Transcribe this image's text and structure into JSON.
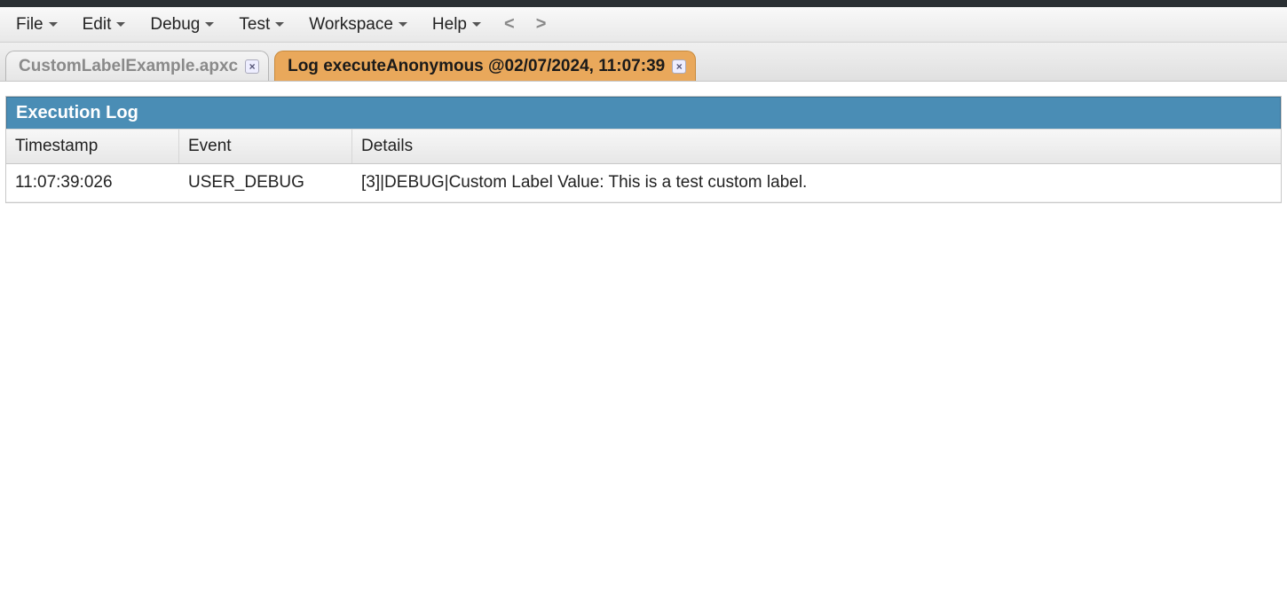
{
  "menu": {
    "items": [
      "File",
      "Edit",
      "Debug",
      "Test",
      "Workspace",
      "Help"
    ],
    "back": "<",
    "forward": ">"
  },
  "tabs": [
    {
      "label": "CustomLabelExample.apxc",
      "active": false
    },
    {
      "label": "Log executeAnonymous @02/07/2024, 11:07:39",
      "active": true
    }
  ],
  "panel": {
    "title": "Execution Log",
    "columns": {
      "timestamp": "Timestamp",
      "event": "Event",
      "details": "Details"
    },
    "rows": [
      {
        "timestamp": "11:07:39:026",
        "event": "USER_DEBUG",
        "details": "[3]|DEBUG|Custom Label Value: This is a test custom label."
      }
    ]
  }
}
